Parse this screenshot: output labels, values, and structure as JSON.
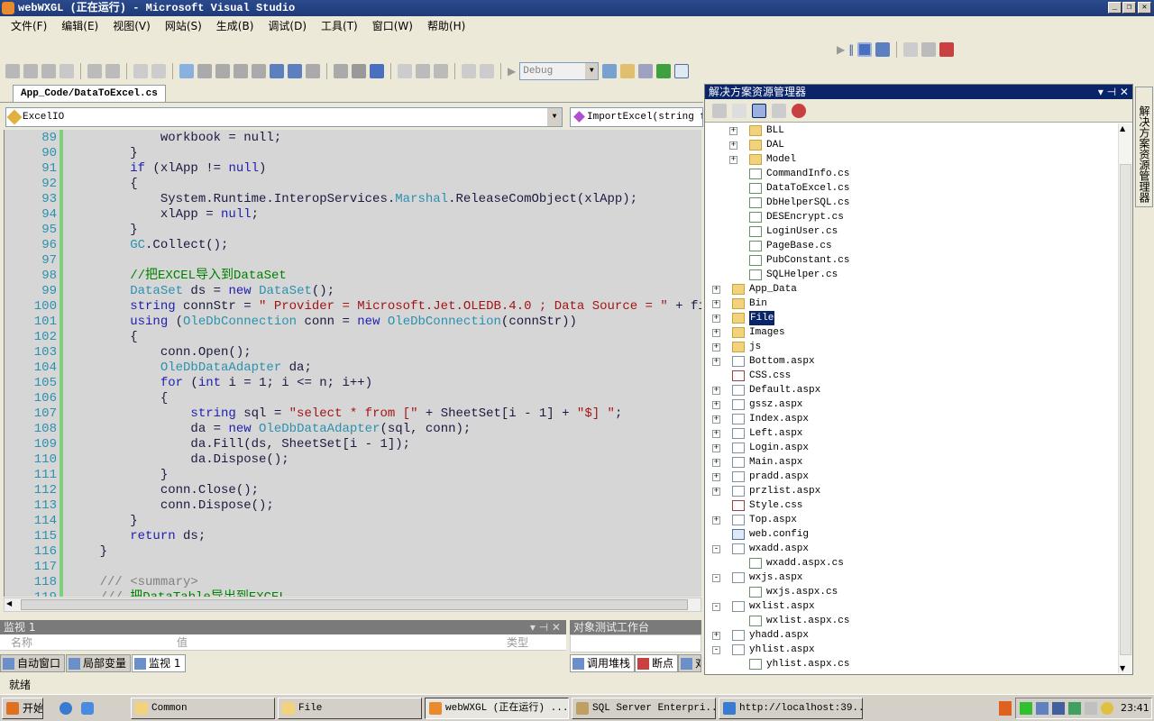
{
  "window": {
    "title": "webWXGL (正在运行) - Microsoft Visual Studio"
  },
  "menu": [
    "文件(F)",
    "编辑(E)",
    "视图(V)",
    "网站(S)",
    "生成(B)",
    "调试(D)",
    "工具(T)",
    "窗口(W)",
    "帮助(H)"
  ],
  "toolbar": {
    "config": "Debug"
  },
  "editor": {
    "tab": "App_Code/DataToExcel.cs",
    "class_combo": "ExcelIO",
    "member_combo": "ImportExcel(string fi",
    "lines": [
      {
        "n": "89",
        "t": [
          [
            "pl",
            "            workbook = null;"
          ]
        ]
      },
      {
        "n": "90",
        "t": [
          [
            "pl",
            "        }"
          ]
        ]
      },
      {
        "n": "91",
        "t": [
          [
            "kw",
            "        if"
          ],
          [
            "pl",
            " (xlApp != "
          ],
          [
            "kw",
            "null"
          ],
          [
            "pl",
            ")"
          ]
        ]
      },
      {
        "n": "92",
        "t": [
          [
            "pl",
            "        {"
          ]
        ]
      },
      {
        "n": "93",
        "t": [
          [
            "pl",
            "            System.Runtime.InteropServices."
          ],
          [
            "ty",
            "Marshal"
          ],
          [
            "pl",
            ".ReleaseComObject(xlApp);"
          ]
        ]
      },
      {
        "n": "94",
        "t": [
          [
            "pl",
            "            xlApp = "
          ],
          [
            "kw",
            "null"
          ],
          [
            "pl",
            ";"
          ]
        ]
      },
      {
        "n": "95",
        "t": [
          [
            "pl",
            "        }"
          ]
        ]
      },
      {
        "n": "96",
        "t": [
          [
            "ty",
            "        GC"
          ],
          [
            "pl",
            ".Collect();"
          ]
        ]
      },
      {
        "n": "97",
        "t": [
          [
            "pl",
            ""
          ]
        ]
      },
      {
        "n": "98",
        "t": [
          [
            "cm",
            "        //把EXCEL导入到DataSet"
          ]
        ]
      },
      {
        "n": "99",
        "t": [
          [
            "ty",
            "        DataSet"
          ],
          [
            "pl",
            " ds = "
          ],
          [
            "kw",
            "new"
          ],
          [
            "ty",
            " DataSet"
          ],
          [
            "pl",
            "();"
          ]
        ]
      },
      {
        "n": "100",
        "t": [
          [
            "kw",
            "        string"
          ],
          [
            "pl",
            " connStr = "
          ],
          [
            "st",
            "\" Provider = Microsoft.Jet.OLEDB.4.0 ; Data Source = \""
          ],
          [
            "pl",
            " + fileName"
          ]
        ]
      },
      {
        "n": "101",
        "t": [
          [
            "kw",
            "        using"
          ],
          [
            "pl",
            " ("
          ],
          [
            "ty",
            "OleDbConnection"
          ],
          [
            "pl",
            " conn = "
          ],
          [
            "kw",
            "new"
          ],
          [
            "ty",
            " OleDbConnection"
          ],
          [
            "pl",
            "(connStr))"
          ]
        ]
      },
      {
        "n": "102",
        "t": [
          [
            "pl",
            "        {"
          ]
        ]
      },
      {
        "n": "103",
        "t": [
          [
            "pl",
            "            conn.Open();"
          ]
        ]
      },
      {
        "n": "104",
        "t": [
          [
            "ty",
            "            OleDbDataAdapter"
          ],
          [
            "pl",
            " da;"
          ]
        ]
      },
      {
        "n": "105",
        "t": [
          [
            "kw",
            "            for"
          ],
          [
            "pl",
            " ("
          ],
          [
            "kw",
            "int"
          ],
          [
            "pl",
            " i = 1; i <= n; i++)"
          ]
        ]
      },
      {
        "n": "106",
        "t": [
          [
            "pl",
            "            {"
          ]
        ]
      },
      {
        "n": "107",
        "t": [
          [
            "kw",
            "                string"
          ],
          [
            "pl",
            " sql = "
          ],
          [
            "st",
            "\"select * from [\""
          ],
          [
            "pl",
            " + SheetSet[i - 1] + "
          ],
          [
            "st",
            "\"$] \""
          ],
          [
            "pl",
            ";"
          ]
        ]
      },
      {
        "n": "108",
        "t": [
          [
            "pl",
            "                da = "
          ],
          [
            "kw",
            "new"
          ],
          [
            "ty",
            " OleDbDataAdapter"
          ],
          [
            "pl",
            "(sql, conn);"
          ]
        ]
      },
      {
        "n": "109",
        "t": [
          [
            "pl",
            "                da.Fill(ds, SheetSet[i - 1]);"
          ]
        ]
      },
      {
        "n": "110",
        "t": [
          [
            "pl",
            "                da.Dispose();"
          ]
        ]
      },
      {
        "n": "111",
        "t": [
          [
            "pl",
            "            }"
          ]
        ]
      },
      {
        "n": "112",
        "t": [
          [
            "pl",
            "            conn.Close();"
          ]
        ]
      },
      {
        "n": "113",
        "t": [
          [
            "pl",
            "            conn.Dispose();"
          ]
        ]
      },
      {
        "n": "114",
        "t": [
          [
            "pl",
            "        }"
          ]
        ]
      },
      {
        "n": "115",
        "t": [
          [
            "kw",
            "        return"
          ],
          [
            "pl",
            " ds;"
          ]
        ]
      },
      {
        "n": "116",
        "t": [
          [
            "pl",
            "    }"
          ]
        ]
      },
      {
        "n": "117",
        "t": [
          [
            "pl",
            ""
          ]
        ]
      },
      {
        "n": "118",
        "t": [
          [
            "dc",
            "    /// <summary>"
          ]
        ]
      },
      {
        "n": "119",
        "t": [
          [
            "dc",
            "    /// "
          ],
          [
            "cm",
            "把DataTable导出到EXCEL"
          ]
        ]
      }
    ]
  },
  "watch": {
    "title": "监视 1",
    "col_name": "名称",
    "col_value": "值",
    "col_type": "类型",
    "tabs": [
      "自动窗口",
      "局部变量",
      "监视 1"
    ]
  },
  "object_bench": {
    "title": "对象测试工作台",
    "tabs": [
      "调用堆栈",
      "断点",
      "对"
    ]
  },
  "solution_explorer": {
    "title": "解决方案资源管理器",
    "side_tab": "解决方案资源管理器",
    "items": [
      {
        "label": "BLL",
        "level": 1,
        "icon": "folder",
        "expander": "+"
      },
      {
        "label": "DAL",
        "level": 1,
        "icon": "folder",
        "expander": "+"
      },
      {
        "label": "Model",
        "level": 1,
        "icon": "folder",
        "expander": "+"
      },
      {
        "label": "CommandInfo.cs",
        "level": 1,
        "icon": "cs"
      },
      {
        "label": "DataToExcel.cs",
        "level": 1,
        "icon": "cs"
      },
      {
        "label": "DbHelperSQL.cs",
        "level": 1,
        "icon": "cs"
      },
      {
        "label": "DESEncrypt.cs",
        "level": 1,
        "icon": "cs"
      },
      {
        "label": "LoginUser.cs",
        "level": 1,
        "icon": "cs"
      },
      {
        "label": "PageBase.cs",
        "level": 1,
        "icon": "cs"
      },
      {
        "label": "PubConstant.cs",
        "level": 1,
        "icon": "cs"
      },
      {
        "label": "SQLHelper.cs",
        "level": 1,
        "icon": "cs"
      },
      {
        "label": "App_Data",
        "level": 0,
        "icon": "folder",
        "expander": "+"
      },
      {
        "label": "Bin",
        "level": 0,
        "icon": "folder",
        "expander": "+"
      },
      {
        "label": "File",
        "level": 0,
        "icon": "folder",
        "expander": "+",
        "selected": true
      },
      {
        "label": "Images",
        "level": 0,
        "icon": "folder",
        "expander": "+"
      },
      {
        "label": "js",
        "level": 0,
        "icon": "folder",
        "expander": "+"
      },
      {
        "label": "Bottom.aspx",
        "level": 0,
        "icon": "aspx",
        "expander": "+"
      },
      {
        "label": "CSS.css",
        "level": 0,
        "icon": "css"
      },
      {
        "label": "Default.aspx",
        "level": 0,
        "icon": "aspx",
        "expander": "+"
      },
      {
        "label": "gssz.aspx",
        "level": 0,
        "icon": "aspx",
        "expander": "+"
      },
      {
        "label": "Index.aspx",
        "level": 0,
        "icon": "aspx",
        "expander": "+"
      },
      {
        "label": "Left.aspx",
        "level": 0,
        "icon": "aspx",
        "expander": "+"
      },
      {
        "label": "Login.aspx",
        "level": 0,
        "icon": "aspx",
        "expander": "+"
      },
      {
        "label": "Main.aspx",
        "level": 0,
        "icon": "aspx",
        "expander": "+"
      },
      {
        "label": "pradd.aspx",
        "level": 0,
        "icon": "aspx",
        "expander": "+"
      },
      {
        "label": "przlist.aspx",
        "level": 0,
        "icon": "aspx",
        "expander": "+"
      },
      {
        "label": "Style.css",
        "level": 0,
        "icon": "css"
      },
      {
        "label": "Top.aspx",
        "level": 0,
        "icon": "aspx",
        "expander": "+"
      },
      {
        "label": "web.config",
        "level": 0,
        "icon": "cfg"
      },
      {
        "label": "wxadd.aspx",
        "level": 0,
        "icon": "aspx",
        "expander": "-"
      },
      {
        "label": "wxadd.aspx.cs",
        "level": 1,
        "icon": "cs"
      },
      {
        "label": "wxjs.aspx",
        "level": 0,
        "icon": "aspx",
        "expander": "-"
      },
      {
        "label": "wxjs.aspx.cs",
        "level": 1,
        "icon": "cs"
      },
      {
        "label": "wxlist.aspx",
        "level": 0,
        "icon": "aspx",
        "expander": "-"
      },
      {
        "label": "wxlist.aspx.cs",
        "level": 1,
        "icon": "cs"
      },
      {
        "label": "yhadd.aspx",
        "level": 0,
        "icon": "aspx",
        "expander": "+"
      },
      {
        "label": "yhlist.aspx",
        "level": 0,
        "icon": "aspx",
        "expander": "-"
      },
      {
        "label": "yhlist.aspx.cs",
        "level": 1,
        "icon": "cs"
      }
    ]
  },
  "status": "就绪",
  "taskbar": {
    "start": "开始",
    "tasks": [
      "Common",
      "File",
      "webWXGL (正在运行) ...",
      "SQL Server Enterpri...",
      "http://localhost:39..."
    ],
    "clock": "23:41"
  }
}
